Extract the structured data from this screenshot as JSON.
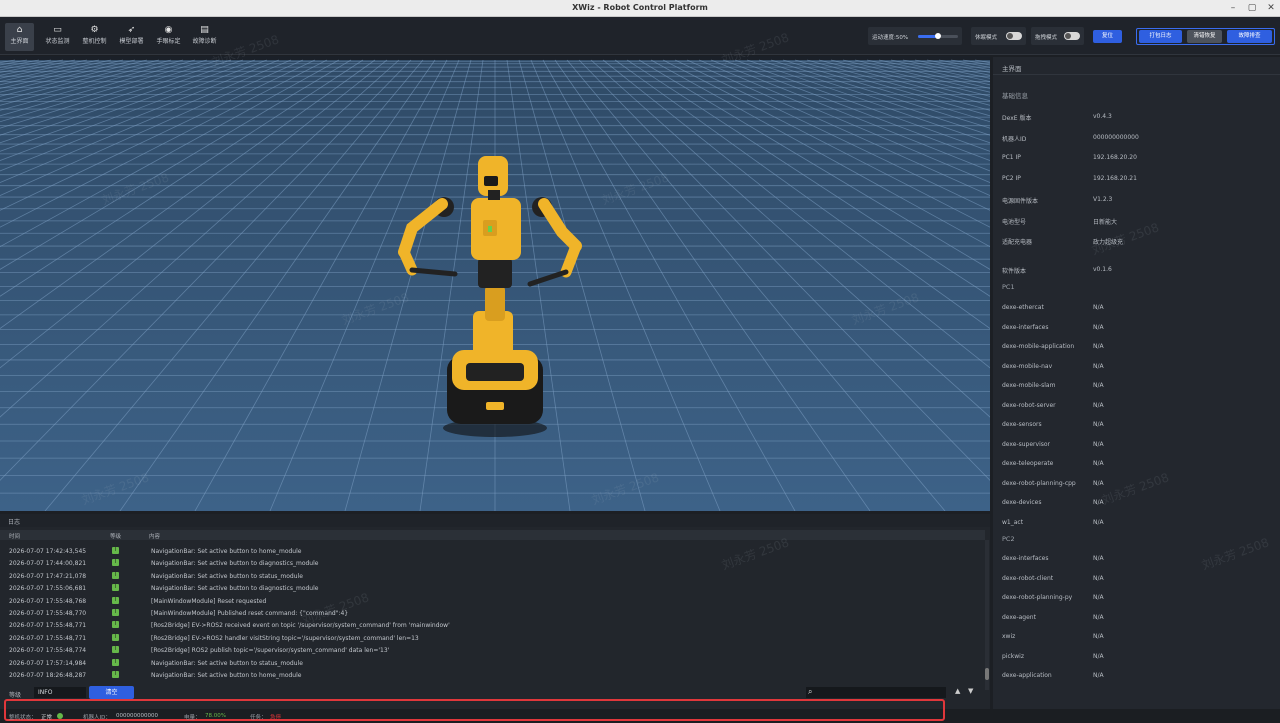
{
  "window": {
    "title": "XWiz - Robot Control Platform"
  },
  "toolbar": {
    "nav": [
      {
        "label": "主界面",
        "icon": "home-icon"
      },
      {
        "label": "状态监测",
        "icon": "monitor-icon"
      },
      {
        "label": "整机控制",
        "icon": "joystick-icon"
      },
      {
        "label": "模型部署",
        "icon": "rocket-icon"
      },
      {
        "label": "手眼标定",
        "icon": "calibration-icon"
      },
      {
        "label": "故障诊断",
        "icon": "document-icon"
      }
    ],
    "speed_label": "运动速度:50%",
    "speed_value": 0.5,
    "sleep_mode": "休眠模式",
    "drag_mode": "拖拽模式",
    "reset": "复位",
    "export_log": "打包日志",
    "clear_error": "清错恢复",
    "fault_clear": "故障排查"
  },
  "panel": {
    "title": "主界面",
    "basic_title": "基础信息",
    "basic": [
      {
        "k": "DexE 版本",
        "v": "v0.4.3"
      },
      {
        "k": "机器人ID",
        "v": "000000000000"
      },
      {
        "k": "PC1 IP",
        "v": "192.168.20.20"
      },
      {
        "k": "PC2 IP",
        "v": "192.168.20.21"
      },
      {
        "k": "电源固件版本",
        "v": "V1.2.3"
      },
      {
        "k": "电池型号",
        "v": "日新能大"
      },
      {
        "k": "适配充电器",
        "v": "政力超级充"
      }
    ],
    "software_title": "软件版本",
    "software_version": "v0.1.6",
    "pc1_title": "PC1",
    "pc1": [
      {
        "k": "dexe-ethercat",
        "v": "N/A"
      },
      {
        "k": "dexe-interfaces",
        "v": "N/A"
      },
      {
        "k": "dexe-mobile-application",
        "v": "N/A"
      },
      {
        "k": "dexe-mobile-nav",
        "v": "N/A"
      },
      {
        "k": "dexe-mobile-slam",
        "v": "N/A"
      },
      {
        "k": "dexe-robot-server",
        "v": "N/A"
      },
      {
        "k": "dexe-sensors",
        "v": "N/A"
      },
      {
        "k": "dexe-supervisor",
        "v": "N/A"
      },
      {
        "k": "dexe-teleoperate",
        "v": "N/A"
      },
      {
        "k": "dexe-robot-planning-cpp",
        "v": "N/A"
      },
      {
        "k": "dexe-devices",
        "v": "N/A"
      },
      {
        "k": "w1_act",
        "v": "N/A"
      }
    ],
    "pc2_title": "PC2",
    "pc2": [
      {
        "k": "dexe-interfaces",
        "v": "N/A"
      },
      {
        "k": "dexe-robot-client",
        "v": "N/A"
      },
      {
        "k": "dexe-robot-planning-py",
        "v": "N/A"
      },
      {
        "k": "dexe-agent",
        "v": "N/A"
      },
      {
        "k": "xwiz",
        "v": "N/A"
      },
      {
        "k": "pickwiz",
        "v": "N/A"
      },
      {
        "k": "dexe-application",
        "v": "N/A"
      }
    ]
  },
  "log": {
    "title": "日志",
    "col_time": "时间",
    "col_level": "等级",
    "col_content": "内容",
    "level_badge": "I",
    "rows": [
      {
        "t": "2026-07-07 17:42:43,545",
        "m": "NavigationBar: Set active button to home_module"
      },
      {
        "t": "2026-07-07 17:44:00,821",
        "m": "NavigationBar: Set active button to diagnostics_module"
      },
      {
        "t": "2026-07-07 17:47:21,078",
        "m": "NavigationBar: Set active button to status_module"
      },
      {
        "t": "2026-07-07 17:55:06,681",
        "m": "NavigationBar: Set active button to diagnostics_module"
      },
      {
        "t": "2026-07-07 17:55:48,768",
        "m": "[MainWindowModule] Reset requested"
      },
      {
        "t": "2026-07-07 17:55:48,770",
        "m": "[MainWindowModule] Published reset command: {\"command\":4}"
      },
      {
        "t": "2026-07-07 17:55:48,771",
        "m": "[Ros2Bridge] EV->ROS2 received event on topic '/supervisor/system_command' from 'mainwindow'"
      },
      {
        "t": "2026-07-07 17:55:48,771",
        "m": "[Ros2Bridge] EV->ROS2 handler visitString topic='/supervisor/system_command' len=13"
      },
      {
        "t": "2026-07-07 17:55:48,774",
        "m": "[Ros2Bridge] ROS2 publish topic='/supervisor/system_command' data len='13'"
      },
      {
        "t": "2026-07-07 17:57:14,984",
        "m": "NavigationBar: Set active button to status_module"
      },
      {
        "t": "2026-07-07 18:26:48,287",
        "m": "NavigationBar: Set active button to home_module"
      }
    ],
    "level_label": "等级",
    "level_value": "INFO",
    "clear": "清空"
  },
  "status": {
    "machine_label": "整机状态：",
    "machine_value": "正常",
    "robot_id_label": "机器人ID：",
    "robot_id_value": "000000000000",
    "power_label": "电量：",
    "power_value": "78.00%",
    "task_label": "任务：",
    "task_value": "急停"
  },
  "watermark": "刘永芳 2508",
  "colors": {
    "accent": "#2f5fe0",
    "ok": "#66b84a",
    "alert": "#e0373b",
    "robot": "#f0b429"
  }
}
